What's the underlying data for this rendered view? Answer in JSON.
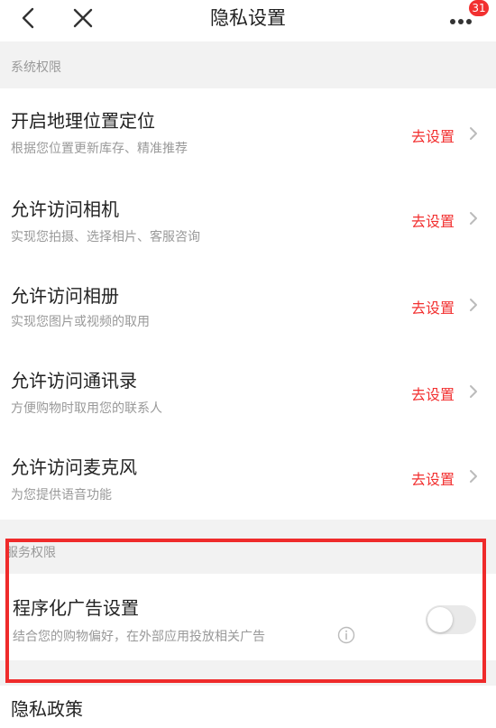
{
  "nav": {
    "title": "隐私设置",
    "badge": "31",
    "back_icon": "chevron-left-icon",
    "close_icon": "close-icon",
    "more_icon": "more-dots-icon"
  },
  "sections": {
    "system": "系统权限",
    "service": "服务权限"
  },
  "permissions": [
    {
      "title": "开启地理位置定位",
      "desc": "根据您位置更新库存、精准推荐",
      "action": "去设置"
    },
    {
      "title": "允许访问相机",
      "desc": "实现您拍摄、选择相片、客服咨询",
      "action": "去设置"
    },
    {
      "title": "允许访问相册",
      "desc": "实现您图片或视频的取用",
      "action": "去设置"
    },
    {
      "title": "允许访问通讯录",
      "desc": "方便购物时取用您的联系人",
      "action": "去设置"
    },
    {
      "title": "允许访问麦克风",
      "desc": "为您提供语音功能",
      "action": "去设置"
    }
  ],
  "ad": {
    "title": "程序化广告设置",
    "desc": "结合您的购物偏好，在外部应用投放相关广告",
    "toggle_on": false
  },
  "privacy_policy": "隐私政策",
  "colors": {
    "accent": "#f23030",
    "highlight": "#ef2b2b",
    "background": "#f2f2f2"
  }
}
